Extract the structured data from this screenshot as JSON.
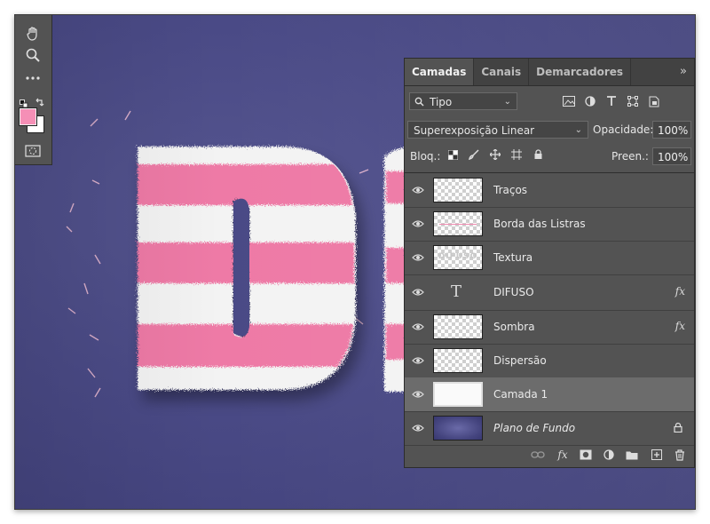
{
  "colors": {
    "canvas_bg": "#4a4a86",
    "panel_bg": "#535353",
    "foreground_swatch": "#f58fb6",
    "background_swatch": "#ffffff",
    "fur_pink": "#ee7aa6",
    "fur_white": "#f4f4f4",
    "selected_row": "#6c6c6c"
  },
  "toolbox": {
    "tools": [
      "hand-tool",
      "zoom-tool",
      "more-tools",
      "swap-colors",
      "quick-mask"
    ]
  },
  "panel": {
    "tabs": [
      "Camadas",
      "Canais",
      "Demarcadores"
    ],
    "active_tab": "Camadas",
    "menu_glyph": "»",
    "filter_kind": "Tipo",
    "blend_mode": "Superexposição Linear",
    "opacity_label": "Opacidade:",
    "opacity_value": "100%",
    "lock_label": "Bloq.:",
    "fill_label": "Preen.:",
    "fill_value": "100%",
    "layers": [
      {
        "name": "Traços",
        "thumb": "transparent",
        "fx": false
      },
      {
        "name": "Borda das Listras",
        "thumb": "stripe",
        "fx": false
      },
      {
        "name": "Textura",
        "thumb": "texture",
        "thumb_text": "DIFUSO",
        "fx": false
      },
      {
        "name": "DIFUSO",
        "thumb": "type",
        "fx": true
      },
      {
        "name": "Sombra",
        "thumb": "transparent",
        "fx": true
      },
      {
        "name": "Dispersão",
        "thumb": "transparent",
        "fx": false
      },
      {
        "name": "Camada 1",
        "thumb": "white",
        "fx": false,
        "selected": true
      },
      {
        "name": "Plano de Fundo",
        "thumb": "background",
        "fx": false,
        "locked": true,
        "italic": true
      }
    ],
    "fx_label": "fx"
  }
}
